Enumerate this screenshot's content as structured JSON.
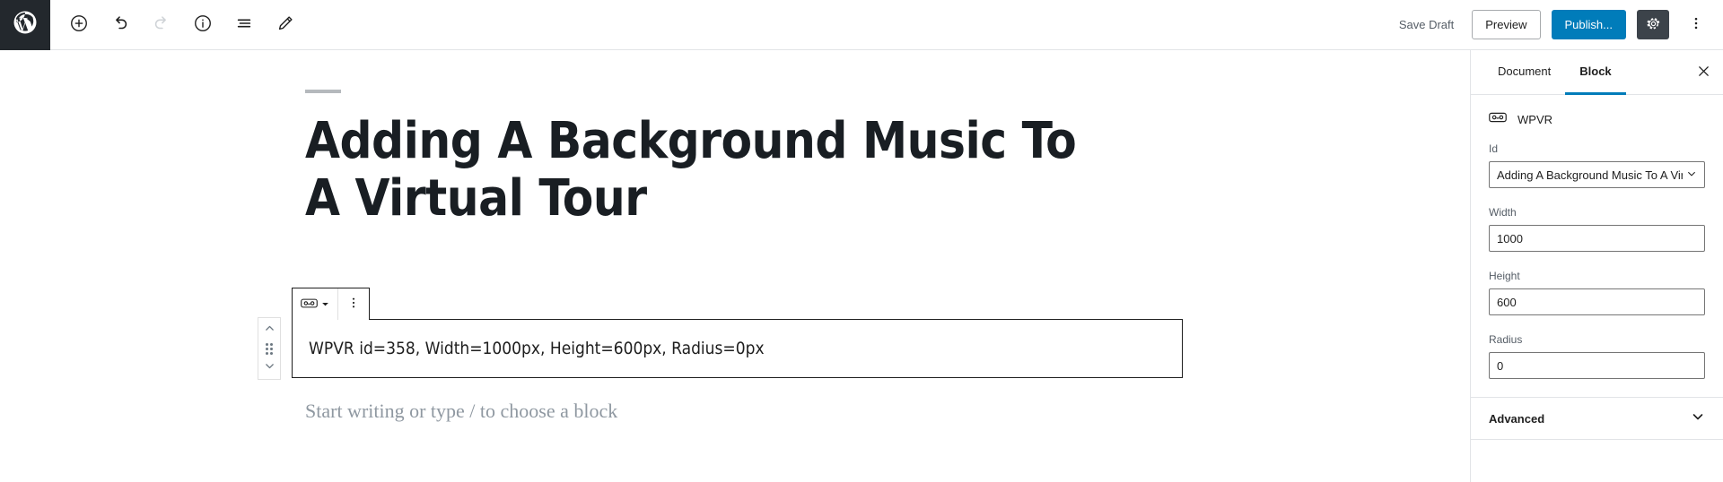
{
  "topbar": {
    "logo_icon": "wordpress-logo-icon",
    "tools": [
      {
        "name": "add-block-button",
        "icon": "plus-circle-icon",
        "disabled": false
      },
      {
        "name": "undo-button",
        "icon": "undo-icon",
        "disabled": false
      },
      {
        "name": "redo-button",
        "icon": "redo-icon",
        "disabled": true
      },
      {
        "name": "details-button",
        "icon": "info-circle-icon",
        "disabled": false
      },
      {
        "name": "list-view-button",
        "icon": "list-view-icon",
        "disabled": false
      },
      {
        "name": "edit-button",
        "icon": "pencil-icon",
        "disabled": false
      }
    ],
    "save_draft_label": "Save Draft",
    "preview_label": "Preview",
    "publish_label": "Publish...",
    "settings_icon": "gear-icon",
    "more_icon": "kebab-menu-icon",
    "publish_color": "#007cba",
    "logo_bg": "#23282d"
  },
  "editor": {
    "post_title": "Adding A Background Music To A Virtual Tour",
    "block_toolbar": {
      "block_type_icon": "vr-goggles-icon",
      "dropdown_icon": "chevron-down-icon",
      "more_options_icon": "kebab-menu-icon"
    },
    "mover": {
      "up_icon": "chevron-up-icon",
      "drag_icon": "drag-handle-icon",
      "down_icon": "chevron-down-icon"
    },
    "block_text": "WPVR id=358, Width=1000px, Height=600px, Radius=0px",
    "placeholder": "Start writing or type / to choose a block"
  },
  "sidebar": {
    "tabs": [
      {
        "label": "Document",
        "active": false
      },
      {
        "label": "Block",
        "active": true
      }
    ],
    "close_icon": "close-icon",
    "block_card": {
      "icon": "vr-goggles-icon",
      "name": "WPVR"
    },
    "fields": [
      {
        "label": "Id",
        "value": "Adding A Background Music To A Virtual Tour",
        "type": "select"
      },
      {
        "label": "Width",
        "value": "1000",
        "type": "text"
      },
      {
        "label": "Height",
        "value": "600",
        "type": "text"
      },
      {
        "label": "Radius",
        "value": "0",
        "type": "text"
      }
    ],
    "advanced": {
      "label": "Advanced",
      "icon": "chevron-down-icon"
    }
  }
}
